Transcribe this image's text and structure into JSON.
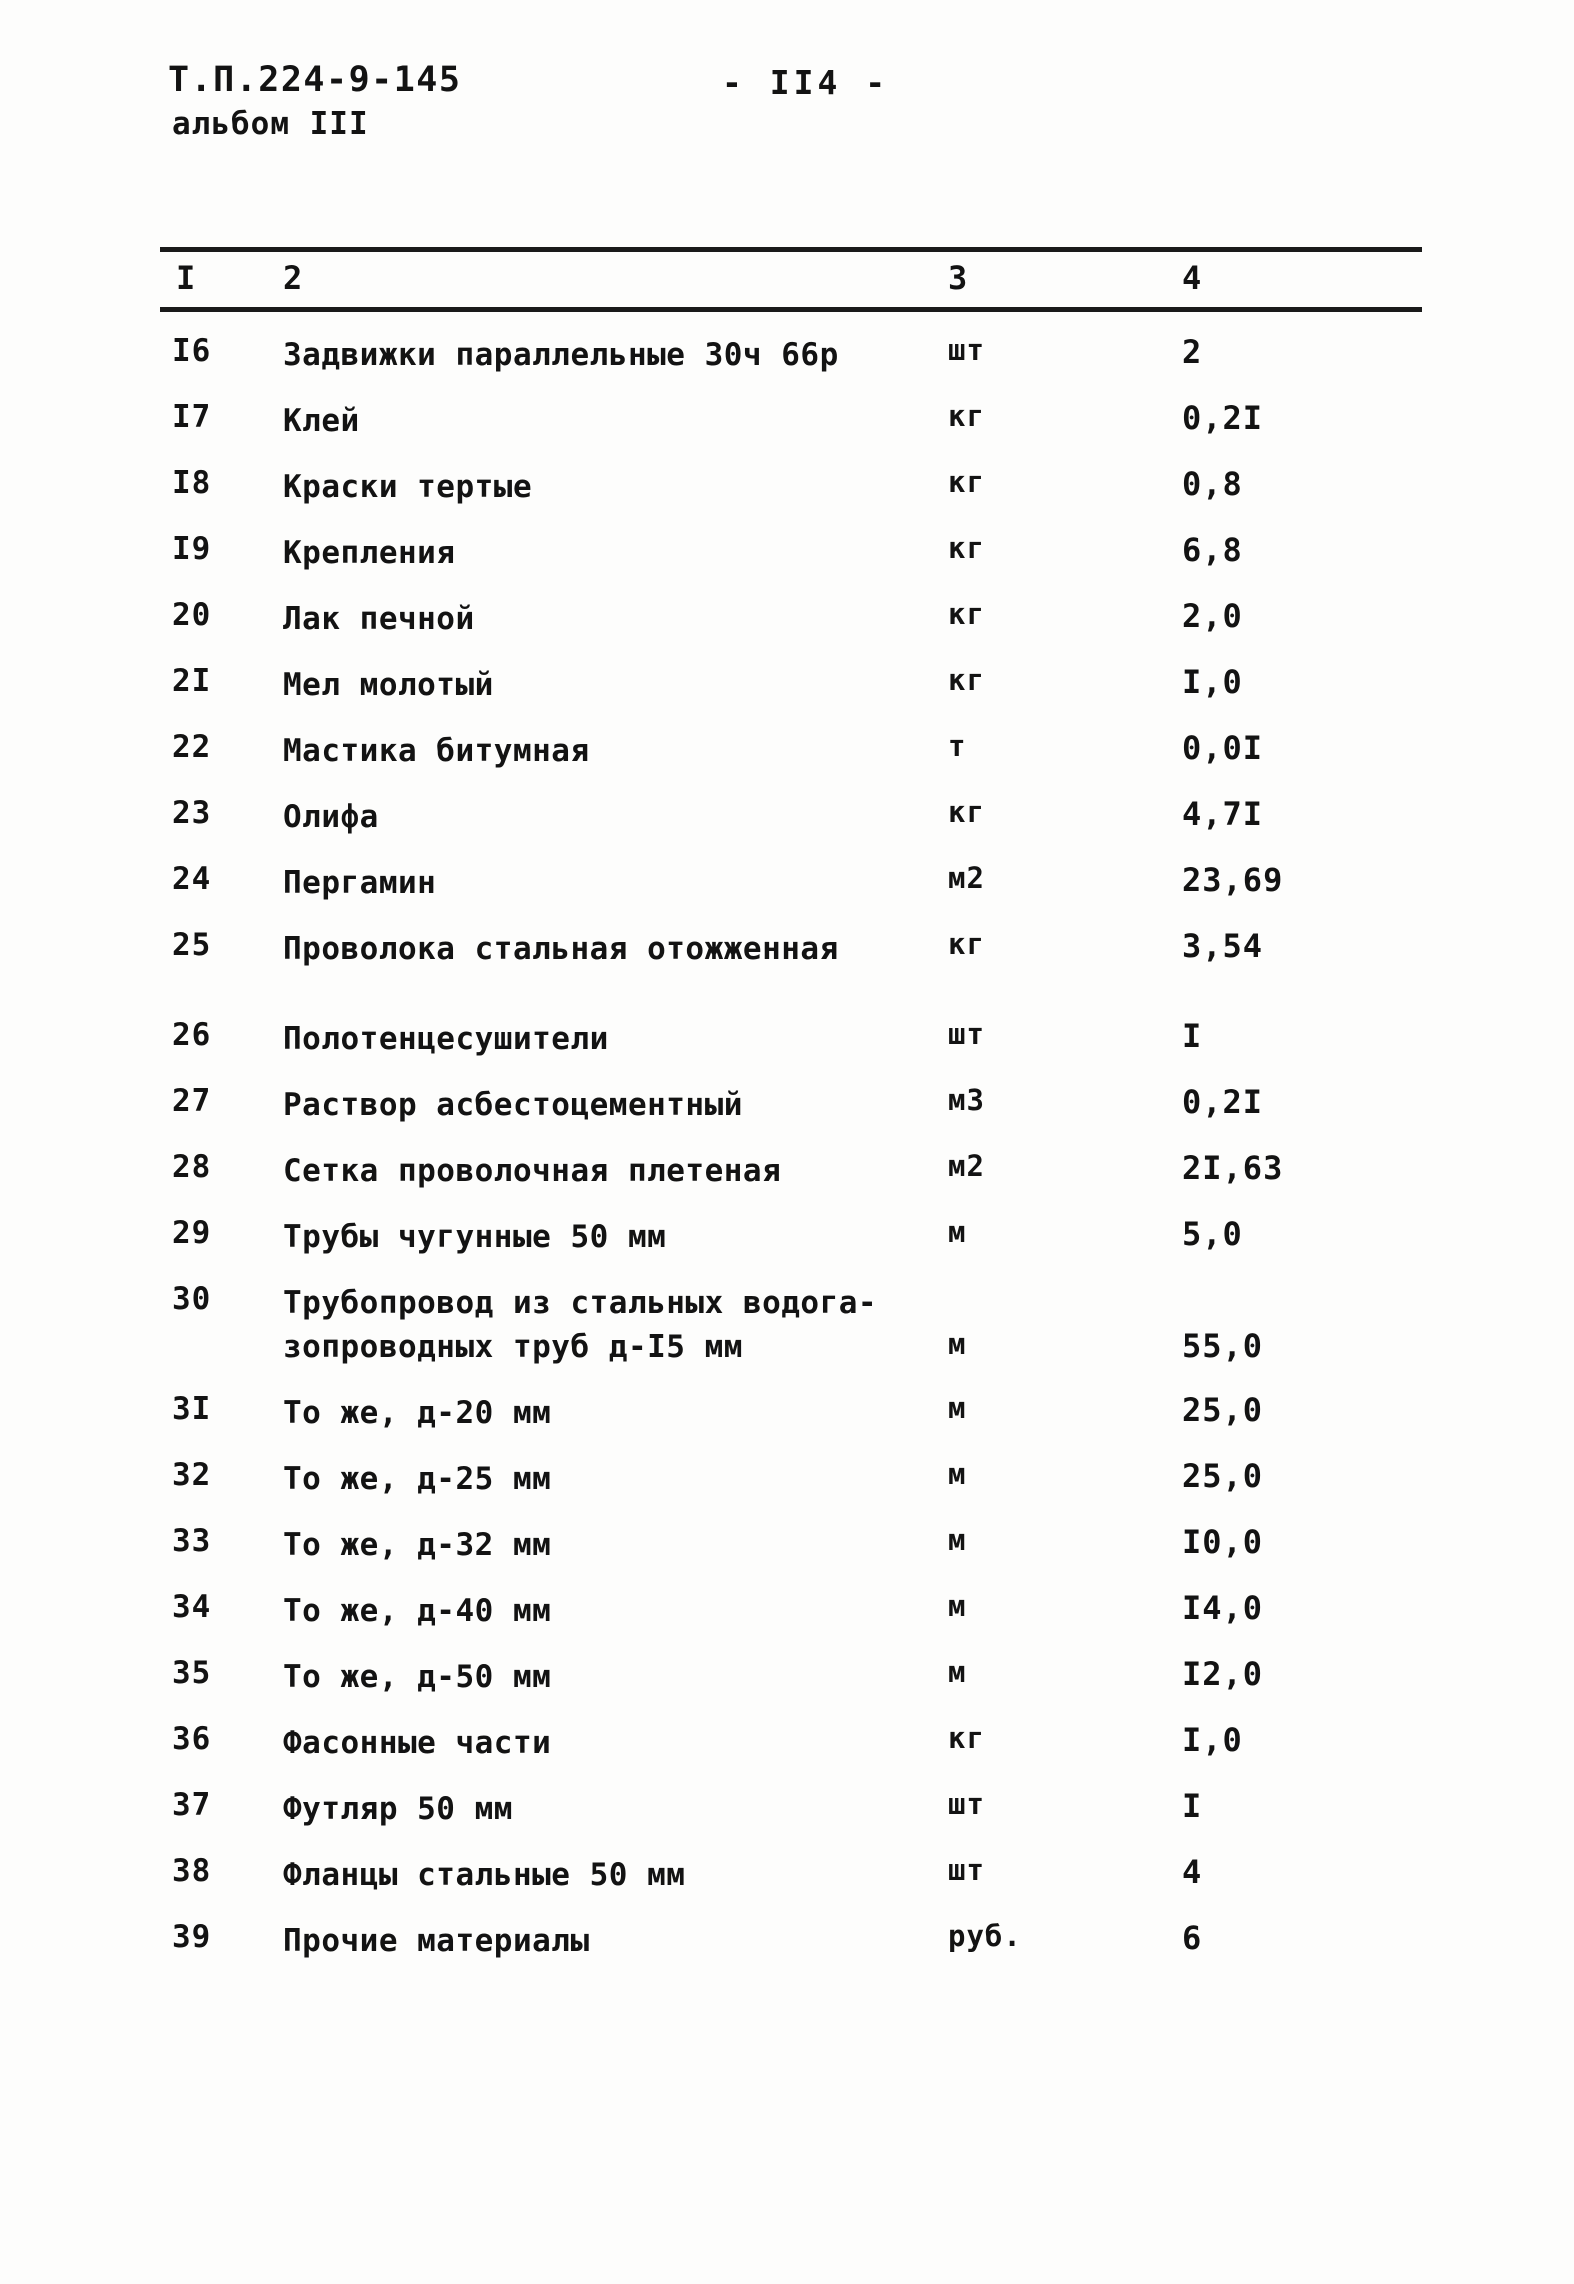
{
  "header": {
    "doc_code": "Т.П.224-9-145",
    "album": "альбом III",
    "page_number": "-  II4  -"
  },
  "table": {
    "columns": [
      "I",
      "2",
      "3",
      "4"
    ],
    "rows": [
      {
        "num": "I6",
        "name": "Задвижки параллельные 30ч 66р",
        "unit": "шт",
        "value": "2",
        "tall": false,
        "gap": false
      },
      {
        "num": "I7",
        "name": "Клей",
        "unit": "кг",
        "value": "0,2I",
        "tall": false,
        "gap": false
      },
      {
        "num": "I8",
        "name": "Краски тертые",
        "unit": "кг",
        "value": "0,8",
        "tall": false,
        "gap": false
      },
      {
        "num": "I9",
        "name": "Крепления",
        "unit": "кг",
        "value": "6,8",
        "tall": false,
        "gap": false
      },
      {
        "num": "20",
        "name": "Лак печной",
        "unit": "кг",
        "value": "2,0",
        "tall": false,
        "gap": false
      },
      {
        "num": "2I",
        "name": "Мел молотый",
        "unit": "кг",
        "value": "I,0",
        "tall": false,
        "gap": false
      },
      {
        "num": "22",
        "name": "Мастика битумная",
        "unit": "т",
        "value": "0,0I",
        "tall": false,
        "gap": false
      },
      {
        "num": "23",
        "name": "Олифа",
        "unit": "кг",
        "value": "4,7I",
        "tall": false,
        "gap": false
      },
      {
        "num": "24",
        "name": "Пергамин",
        "unit": "м2",
        "value": "23,69",
        "tall": false,
        "gap": false
      },
      {
        "num": "25",
        "name": "Проволока стальная отожженная",
        "unit": "кг",
        "value": "3,54",
        "tall": false,
        "gap": false
      },
      {
        "num": "26",
        "name": "Полотенцесушители",
        "unit": "шт",
        "value": "I",
        "tall": false,
        "gap": true
      },
      {
        "num": "27",
        "name": "Раствор асбестоцементный",
        "unit": "м3",
        "value": "0,2I",
        "tall": false,
        "gap": false
      },
      {
        "num": "28",
        "name": "Сетка проволочная плетеная",
        "unit": "м2",
        "value": "2I,63",
        "tall": false,
        "gap": false
      },
      {
        "num": "29",
        "name": "Трубы чугунные 50 мм",
        "unit": "м",
        "value": "5,0",
        "tall": false,
        "gap": false
      },
      {
        "num": "30",
        "name": "Трубопровод из стальных водога-\nзопроводных труб д-I5 мм",
        "unit": "м",
        "value": "55,0",
        "tall": true,
        "gap": false
      },
      {
        "num": "3I",
        "name": "То же, д-20 мм",
        "unit": "м",
        "value": "25,0",
        "tall": false,
        "gap": false
      },
      {
        "num": "32",
        "name": "То же, д-25 мм",
        "unit": "м",
        "value": "25,0",
        "tall": false,
        "gap": false
      },
      {
        "num": "33",
        "name": "То же, д-32 мм",
        "unit": "м",
        "value": "I0,0",
        "tall": false,
        "gap": false
      },
      {
        "num": "34",
        "name": "То же, д-40 мм",
        "unit": "м",
        "value": "I4,0",
        "tall": false,
        "gap": false
      },
      {
        "num": "35",
        "name": "То же, д-50 мм",
        "unit": "м",
        "value": "I2,0",
        "tall": false,
        "gap": false
      },
      {
        "num": "36",
        "name": "Фасонные части",
        "unit": "кг",
        "value": "I,0",
        "tall": false,
        "gap": false
      },
      {
        "num": "37",
        "name": "Футляр 50 мм",
        "unit": "шт",
        "value": "I",
        "tall": false,
        "gap": false
      },
      {
        "num": "38",
        "name": "Фланцы стальные 50 мм",
        "unit": "шт",
        "value": "4",
        "tall": false,
        "gap": false
      },
      {
        "num": "39",
        "name": "Прочие материалы",
        "unit": "руб.",
        "value": "6",
        "tall": false,
        "gap": false
      }
    ]
  }
}
